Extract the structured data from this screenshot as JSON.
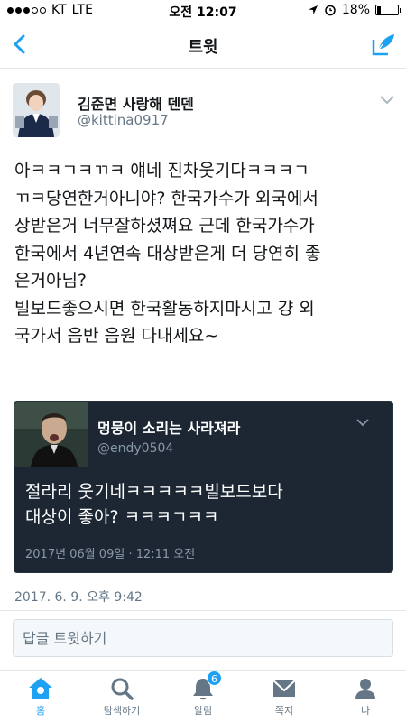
{
  "status_bar": {
    "carrier": "KT",
    "network": "LTE",
    "time": "오전 12:07",
    "battery": "18%",
    "battery_level": 0.18
  },
  "nav": {
    "title": "트윗",
    "back_icon": "chevron-left-icon",
    "compose_icon": "compose-tweet-icon"
  },
  "tweet": {
    "author_name": "김준면 사랑해 덴덴",
    "author_handle": "@kittina0917",
    "text": "아ㅋㅋㄱㅋㄲㅋ 얘네 진차웃기다ㅋㅋㅋㄱ\nㄲㅋ당연한거아니야? 한국가수가 외국에서\n상받은거 너무잘하셨쪄요 근데 한국가수가\n한국에서 4년연속 대상받은게 더 당연히 좋\n은거아님?\n빌보드좋으시면 한국활동하지마시고 걍 외\n국가서 음반 음원 다내세요~",
    "timestamp": "2017. 6. 9. 오후 9:42"
  },
  "quoted_tweet": {
    "author_name": "멍뭉이 소리는 사라져라",
    "author_handle": "@endy0504",
    "text": "절라리 웃기네ㅋㅋㅋㅋㅋ빌보드보다\n대상이 좋아? ㅋㅋㅋㄱㅋㅋ",
    "timestamp": "2017년 06월 09일 · 12:11 오전"
  },
  "reply": {
    "placeholder": "답글 트윗하기"
  },
  "tabbar": {
    "home": "홈",
    "search": "탐색하기",
    "notifications": "알림",
    "notifications_badge": "6",
    "messages": "쪽지",
    "me": "나"
  },
  "colors": {
    "accent": "#1da1f2",
    "quote_bg": "#1c2733",
    "muted": "#657786"
  }
}
